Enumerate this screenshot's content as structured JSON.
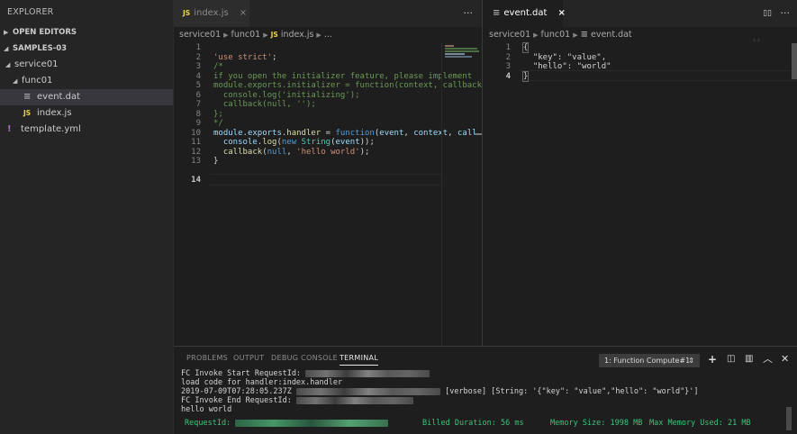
{
  "sidebar": {
    "title": "EXPLORER",
    "open_editors": "OPEN EDITORS",
    "project": "SAMPLES-03",
    "items": [
      {
        "label": "service01"
      },
      {
        "label": "func01"
      },
      {
        "label": "event.dat"
      },
      {
        "label": "index.js"
      },
      {
        "label": "template.yml"
      }
    ]
  },
  "editor1": {
    "tab_label": "index.js",
    "tab_icon": "JS",
    "close": "×",
    "more": "···",
    "breadcrumb": [
      "service01",
      "func01",
      "index.js",
      "..."
    ],
    "line_numbers": [
      "1",
      "2",
      "3",
      "4",
      "5",
      "6",
      "7",
      "8",
      "9",
      "10",
      "11",
      "12",
      "13",
      "14"
    ]
  },
  "editor2": {
    "tab_label": "event.dat",
    "close": "×",
    "split": "▯▯",
    "more": "···",
    "breadcrumb": [
      "service01",
      "func01",
      "event.dat"
    ],
    "line_numbers": [
      "1",
      "2",
      "3",
      "4"
    ],
    "lines": [
      "{",
      "  \"key\": \"value\",",
      "  \"hello\": \"world\"",
      "}"
    ]
  },
  "panel": {
    "tabs": [
      "PROBLEMS",
      "OUTPUT",
      "DEBUG CONSOLE",
      "TERMINAL"
    ],
    "terminal_select": "1: Function Compute#1",
    "terminal": {
      "line1": "FC Invoke Start RequestId:",
      "line2": "load code for handler:index.handler",
      "line3a": "2019-07-09T07:28:05.237Z",
      "line3b": "[verbose] [String: '{\"key\": \"value\",\"hello\": \"world\"}']",
      "line4": "FC Invoke End RequestId:",
      "line5": "hello world",
      "request_id_label": "RequestId:",
      "billed": "Billed Duration: 56 ms",
      "memory": "Memory Size: 1998 MB",
      "max_memory": "Max Memory Used: 21 MB"
    }
  },
  "colors": {
    "keyword": "#569cd6",
    "string": "#ce9178",
    "comment": "#6a9955",
    "function": "#dcdcaa",
    "status_green": "#3ec37b"
  }
}
